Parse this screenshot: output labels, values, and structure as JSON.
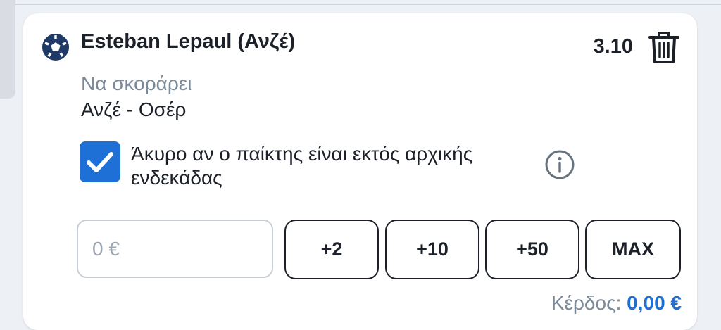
{
  "colors": {
    "accent": "#1e6fd6",
    "text": "#1c2129",
    "muted": "#7a8a9a",
    "background": "#edf0f4"
  },
  "icons": {
    "sport": "football-icon",
    "delete": "trash-icon",
    "check": "checkmark-icon",
    "info": "info-icon"
  },
  "bet": {
    "selection": "Esteban Lepaul (Ανζέ)",
    "odds": "3.10",
    "market": "Να σκοράρει",
    "match": "Ανζέ - Οσέρ",
    "void_option": {
      "checked": true,
      "label": "Άκυρο αν ο παίκτης είναι εκτός αρχικής ενδεκάδας"
    },
    "stake": {
      "value": "",
      "placeholder": "0 €"
    },
    "quick_amounts": [
      "+2",
      "+10",
      "+50",
      "MAX"
    ],
    "profit": {
      "label": "Κέρδος:",
      "value": "0,00 €"
    }
  }
}
